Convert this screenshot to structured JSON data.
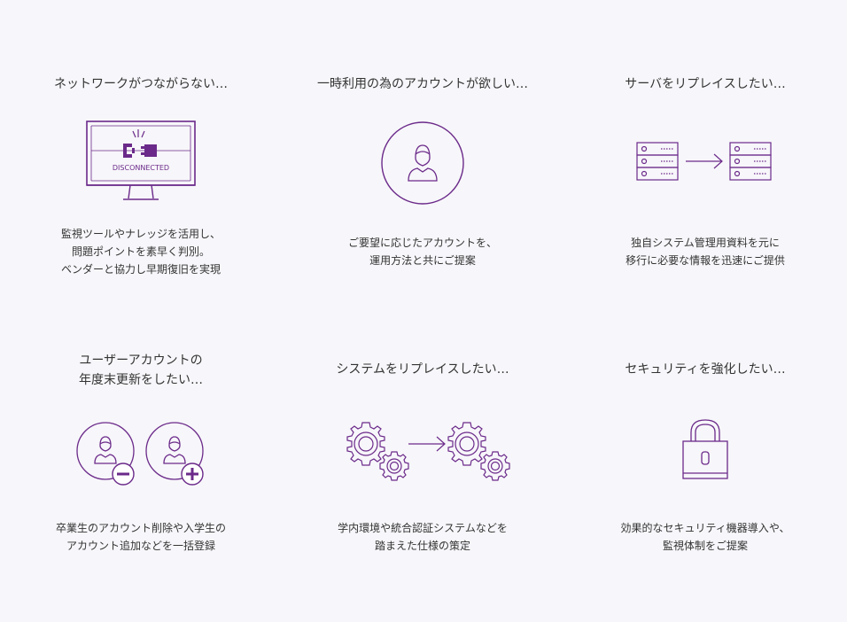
{
  "colors": {
    "background": "#f7f6fa",
    "accent": "#6b2a8a",
    "text": "#333333"
  },
  "cards": [
    {
      "title": [
        "ネットワークがつながらない…"
      ],
      "icon": "disconnected-monitor-icon",
      "icon_label": "DISCONNECTED",
      "desc": [
        "監視ツールやナレッジを活用し、",
        "問題ポイントを素早く判別。",
        "ベンダーと協力し早期復旧を実現"
      ]
    },
    {
      "title": [
        "一時利用の為のアカウントが欲しい…"
      ],
      "icon": "user-account-icon",
      "desc": [
        "ご要望に応じたアカウントを、",
        "運用方法と共にご提案"
      ]
    },
    {
      "title": [
        "サーバをリプレイスしたい…"
      ],
      "icon": "server-replace-icon",
      "desc": [
        "独自システム管理用資料を元に",
        "移行に必要な情報を迅速にご提供"
      ]
    },
    {
      "title": [
        "ユーザーアカウントの",
        "年度末更新をしたい…"
      ],
      "icon": "user-add-remove-icon",
      "desc": [
        "卒業生のアカウント削除や入学生の",
        "アカウント追加などを一括登録"
      ]
    },
    {
      "title": [
        "システムをリプレイスしたい…"
      ],
      "icon": "gears-replace-icon",
      "desc": [
        "学内環境や統合認証システムなどを",
        "踏まえた仕様の策定"
      ]
    },
    {
      "title": [
        "セキュリティを強化したい…"
      ],
      "icon": "padlock-icon",
      "desc": [
        "効果的なセキュリティ機器導入や、",
        "監視体制をご提案"
      ]
    }
  ]
}
